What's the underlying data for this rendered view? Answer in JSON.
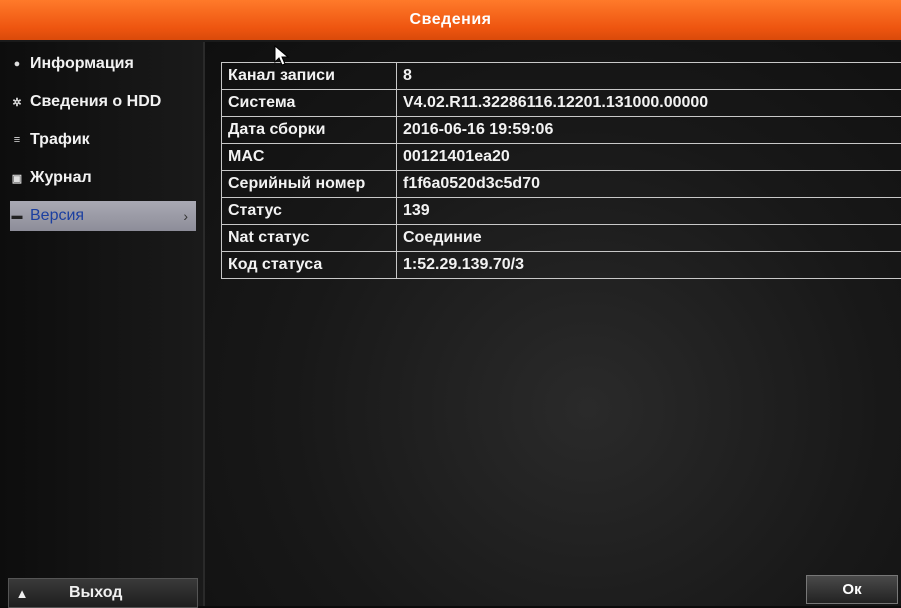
{
  "window": {
    "title": "Сведения"
  },
  "sidebar": {
    "items": [
      {
        "label": "Информация",
        "icon": "info-icon"
      },
      {
        "label": "Сведения о HDD",
        "icon": "gear-icon"
      },
      {
        "label": "Трафик",
        "icon": "list-icon"
      },
      {
        "label": "Журнал",
        "icon": "log-icon"
      },
      {
        "label": "Версия",
        "icon": "version-icon",
        "active": true
      }
    ],
    "exit_label": "Выход"
  },
  "info_table": [
    {
      "key": "Канал записи",
      "value": "8"
    },
    {
      "key": "Система",
      "value": "V4.02.R11.32286116.12201.131000.00000"
    },
    {
      "key": "Дата сборки",
      "value": "2016-06-16 19:59:06"
    },
    {
      "key": "MAC",
      "value": "00121401ea20"
    },
    {
      "key": "Серийный номер",
      "value": "f1f6a0520d3c5d70"
    },
    {
      "key": "Статус",
      "value": "139"
    },
    {
      "key": "Nat статус",
      "value": "Соединие"
    },
    {
      "key": "Код статуса",
      "value": "1:52.29.139.70/3"
    }
  ],
  "footer": {
    "ok_label": "Ок"
  },
  "colors": {
    "title_bar": "#ee5510",
    "active_item": "#9a9aa5",
    "active_text": "#1b3fa0"
  }
}
